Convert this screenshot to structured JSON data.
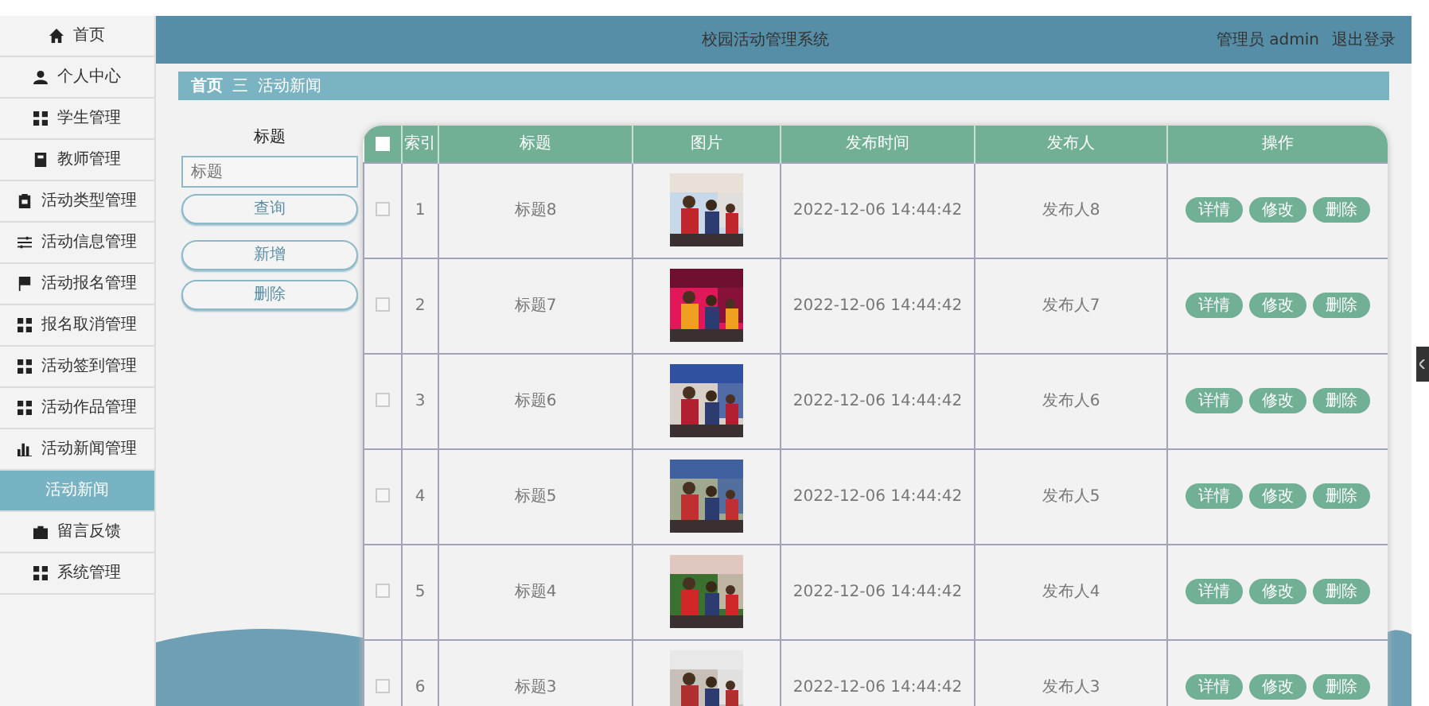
{
  "sidebar": {
    "items": [
      {
        "label": "首页",
        "selected": false
      },
      {
        "label": "个人中心",
        "selected": false
      },
      {
        "label": "学生管理",
        "selected": false
      },
      {
        "label": "教师管理",
        "selected": false
      },
      {
        "label": "活动类型管理",
        "selected": false
      },
      {
        "label": "活动信息管理",
        "selected": false
      },
      {
        "label": "活动报名管理",
        "selected": false
      },
      {
        "label": "报名取消管理",
        "selected": false
      },
      {
        "label": "活动签到管理",
        "selected": false
      },
      {
        "label": "活动作品管理",
        "selected": false
      },
      {
        "label": "活动新闻管理",
        "selected": false,
        "expanded": true,
        "children": [
          {
            "label": "活动新闻",
            "selected": true
          }
        ]
      },
      {
        "label": "留言反馈",
        "selected": false
      },
      {
        "label": "系统管理",
        "selected": false
      }
    ]
  },
  "header": {
    "title": "校园活动管理系统",
    "user": "管理员 admin",
    "logout": "退出登录"
  },
  "breadcrumb": {
    "home": "首页",
    "separator": "三",
    "current": "活动新闻"
  },
  "search": {
    "label": "标题",
    "placeholder": "标题",
    "buttons": [
      "查询",
      "新增",
      "删除"
    ]
  },
  "table": {
    "select_all": {
      "checked": false
    },
    "columns": [
      "索引",
      "标题",
      "图片",
      "发布时间",
      "发布人",
      "操作"
    ],
    "rows": [
      {
        "checked": false,
        "index": "1",
        "title": "标题8",
        "time": "2022-12-06 14:44:42",
        "publisher": "发布人8",
        "actions": [
          "详情",
          "修改",
          "删除"
        ]
      },
      {
        "checked": false,
        "index": "2",
        "title": "标题7",
        "time": "2022-12-06 14:44:42",
        "publisher": "发布人7",
        "actions": [
          "详情",
          "修改",
          "删除"
        ]
      },
      {
        "checked": false,
        "index": "3",
        "title": "标题6",
        "time": "2022-12-06 14:44:42",
        "publisher": "发布人6",
        "actions": [
          "详情",
          "修改",
          "删除"
        ]
      },
      {
        "checked": false,
        "index": "4",
        "title": "标题5",
        "time": "2022-12-06 14:44:42",
        "publisher": "发布人5",
        "actions": [
          "详情",
          "修改",
          "删除"
        ]
      },
      {
        "checked": false,
        "index": "5",
        "title": "标题4",
        "time": "2022-12-06 14:44:42",
        "publisher": "发布人4",
        "actions": [
          "详情",
          "修改",
          "删除"
        ]
      },
      {
        "checked": false,
        "index": "6",
        "title": "标题3",
        "time": "2022-12-06 14:44:42",
        "publisher": "发布人3",
        "actions": [
          "详情",
          "修改",
          "删除"
        ]
      }
    ]
  }
}
